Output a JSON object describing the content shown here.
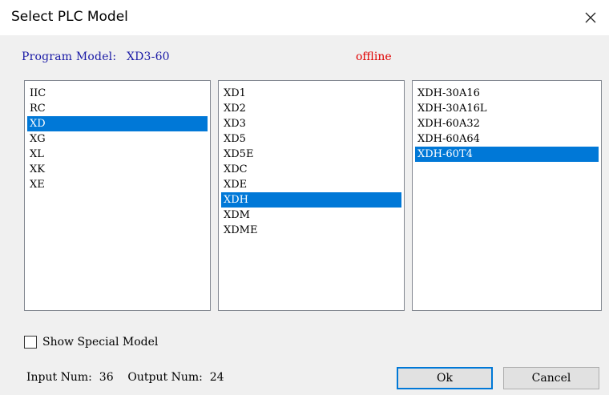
{
  "window": {
    "title": "Select PLC Model"
  },
  "header": {
    "program_model_label": "Program Model:",
    "program_model_value": "XD3-60",
    "status": "offline"
  },
  "lists": {
    "series": {
      "items": [
        "IIC",
        "RC",
        "XD",
        "XG",
        "XL",
        "XK",
        "XE"
      ],
      "selected": "XD"
    },
    "models": {
      "items": [
        "XD1",
        "XD2",
        "XD3",
        "XD5",
        "XD5E",
        "XDC",
        "XDE",
        "XDH",
        "XDM",
        "XDME"
      ],
      "selected": "XDH"
    },
    "variants": {
      "items": [
        "XDH-30A16",
        "XDH-30A16L",
        "XDH-60A32",
        "XDH-60A64",
        "XDH-60T4"
      ],
      "selected": "XDH-60T4"
    }
  },
  "options": {
    "show_special_label": "Show Special Model",
    "show_special_checked": false
  },
  "counts": {
    "input_label": "Input Num:",
    "input_value": "36",
    "output_label": "Output Num:",
    "output_value": "24"
  },
  "buttons": {
    "ok": "Ok",
    "cancel": "Cancel"
  },
  "colors": {
    "selection": "#0078d7",
    "status": "#e00000",
    "program_model": "#1a1aa6"
  }
}
